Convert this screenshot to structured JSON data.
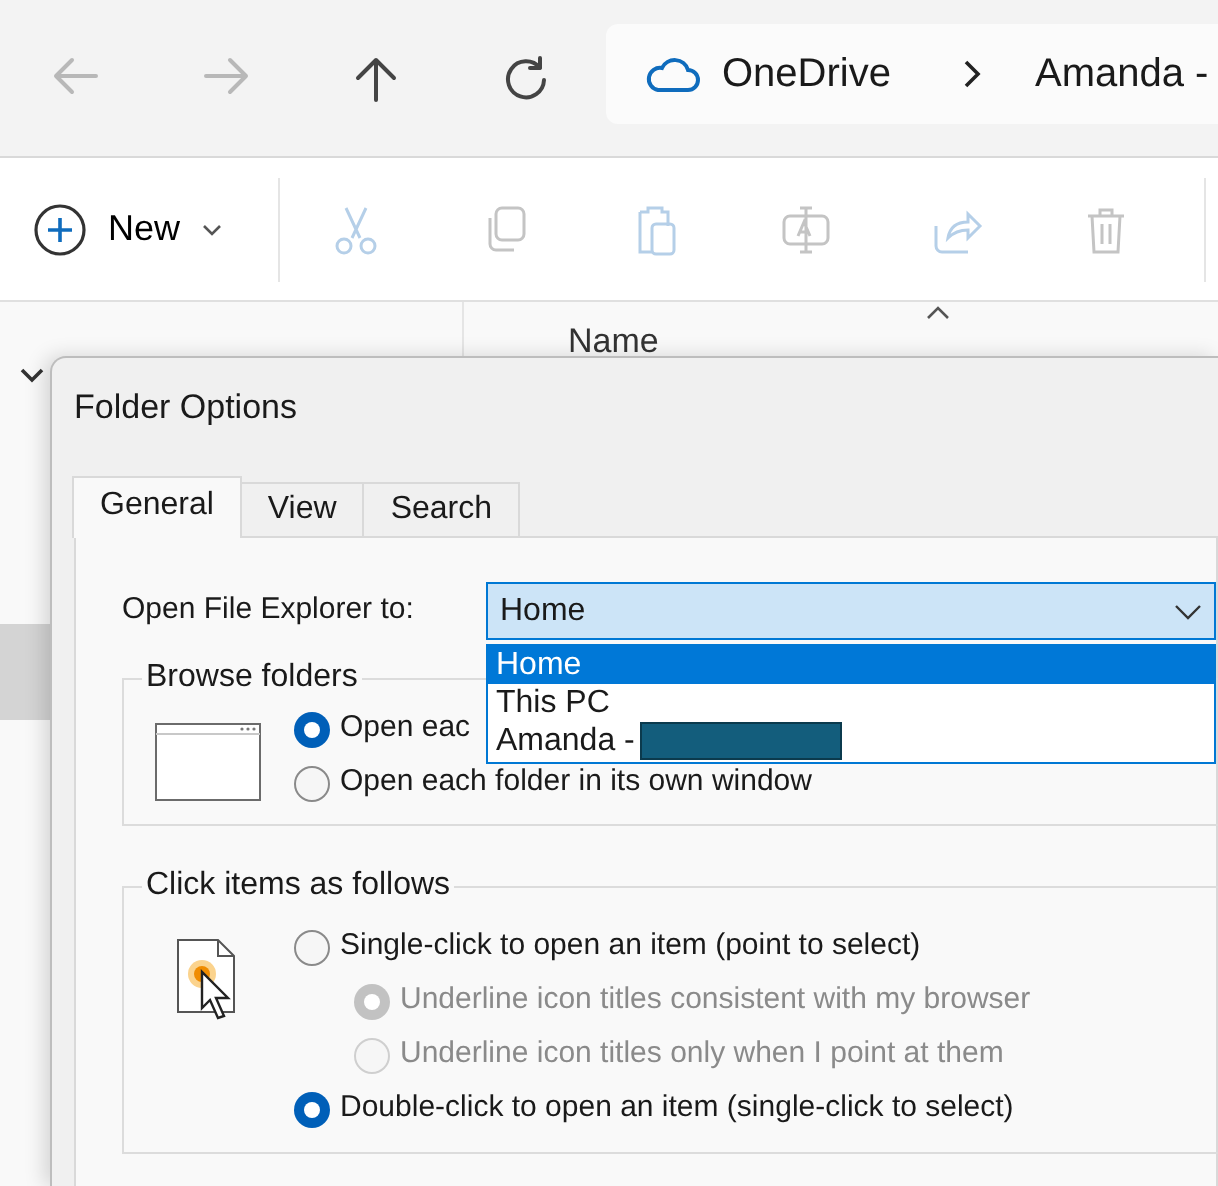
{
  "explorer": {
    "nav_buttons": [
      {
        "kind": "back",
        "disabled": true
      },
      {
        "kind": "forward",
        "disabled": true
      },
      {
        "kind": "up",
        "disabled": false
      },
      {
        "kind": "refresh",
        "disabled": false
      }
    ],
    "breadcrumb": [
      "OneDrive",
      "Amanda -"
    ],
    "new_button": {
      "label": "New"
    },
    "actions": [
      {
        "kind": "cut",
        "disabled": true
      },
      {
        "kind": "copy",
        "disabled": true
      },
      {
        "kind": "paste",
        "disabled": true
      },
      {
        "kind": "rename",
        "disabled": true
      },
      {
        "kind": "share",
        "disabled": true
      },
      {
        "kind": "delete",
        "disabled": true
      }
    ],
    "column_header": "Name"
  },
  "dialog": {
    "title": "Folder Options",
    "tabs": [
      {
        "label": "General",
        "selected": true
      },
      {
        "label": "View",
        "selected": false
      },
      {
        "label": "Search",
        "selected": false
      }
    ],
    "open_to": {
      "label": "Open File Explorer to:",
      "value": "Home",
      "expanded": true,
      "options": [
        {
          "label": "Home",
          "selected": true,
          "redacted": false
        },
        {
          "label": "This PC",
          "selected": false,
          "redacted": false
        },
        {
          "label": "Amanda -",
          "selected": false,
          "redacted": true
        }
      ]
    },
    "groups": [
      {
        "title": "Browse folders",
        "kind": "browse",
        "options": [
          {
            "label": "Open eac",
            "checked": true,
            "disabled": false
          },
          {
            "label": "Open each folder in its own window",
            "checked": false,
            "disabled": false
          }
        ]
      },
      {
        "title": "Click items as follows",
        "kind": "click",
        "options": [
          {
            "label": "Single-click to open an item (point to select)",
            "checked": false,
            "disabled": false,
            "children": [
              {
                "label": "Underline icon titles consistent with my browser",
                "checked": true,
                "disabled": true
              },
              {
                "label": "Underline icon titles only when I point at them",
                "checked": false,
                "disabled": true
              }
            ]
          },
          {
            "label": "Double-click to open an item (single-click to select)",
            "checked": true,
            "disabled": false
          }
        ]
      }
    ]
  }
}
